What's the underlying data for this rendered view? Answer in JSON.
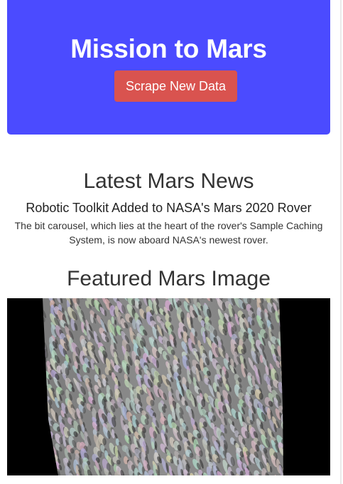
{
  "theme": {
    "jumbotron_bg": "#4b4bff",
    "button_bg": "#d9534f"
  },
  "header": {
    "title": "Mission to Mars",
    "scrape_button_label": "Scrape New Data"
  },
  "news": {
    "heading": "Latest Mars News",
    "title": "Robotic Toolkit Added to NASA's Mars 2020 Rover",
    "teaser": "The bit carousel, which lies at the heart of the rover's Sample Caching System, is now aboard NASA's newest rover."
  },
  "featured_image": {
    "heading": "Featured Mars Image",
    "subject": "grayscale orbital image of martian dune field"
  }
}
